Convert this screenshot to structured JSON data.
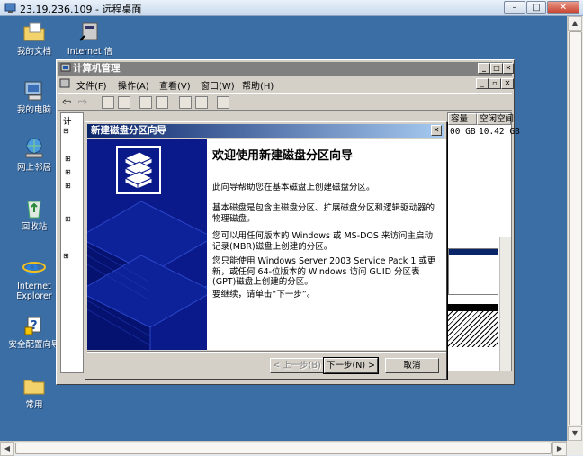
{
  "rdp": {
    "title": "23.19.236.109 - 远程桌面",
    "min": "–",
    "max": "□",
    "close": "✕"
  },
  "desktop_icons": [
    {
      "name": "my-documents",
      "label": "我的文档"
    },
    {
      "name": "internet-shortcut",
      "label": "Internet 信\n息服务(..."
    },
    {
      "name": "my-computer",
      "label": "我的电脑"
    },
    {
      "name": "network-places",
      "label": "网上邻居"
    },
    {
      "name": "recycle-bin",
      "label": "回收站"
    },
    {
      "name": "internet-explorer",
      "label": "Internet\nExplorer"
    },
    {
      "name": "security-config",
      "label": "安全配置向导"
    },
    {
      "name": "common-folder",
      "label": "常用"
    }
  ],
  "cm": {
    "title": "计算机管理",
    "menu": [
      "文件(F)",
      "操作(A)",
      "查看(V)",
      "窗口(W)",
      "帮助(H)"
    ],
    "tree_root": "计",
    "columns": [
      "容量",
      "空闲空间"
    ],
    "row": [
      "00 GB",
      "10.42 GB"
    ]
  },
  "wizard": {
    "title": "新建磁盘分区向导",
    "close": "✕",
    "heading": "欢迎使用新建磁盘分区向导",
    "p1": "此向导帮助您在基本磁盘上创建磁盘分区。",
    "p2": "基本磁盘是包含主磁盘分区、扩展磁盘分区和逻辑驱动器的物理磁盘。",
    "p3": "您可以用任何版本的 Windows 或 MS-DOS 来访问主启动记录(MBR)磁盘上创建的分区。",
    "p4": "您只能使用 Windows Server 2003 Service Pack 1 或更新，或任何 64-位版本的 Windows 访问 GUID 分区表(GPT)磁盘上创建的分区。",
    "p5": "要继续，请单击“下一步”。",
    "back": "< 上一步(B)",
    "next": "下一步(N) >",
    "cancel": "取消"
  },
  "colors": {
    "desktop": "#3a6ea5",
    "wizard_banner": "#0a1a8a",
    "title_active": "#0a246a"
  }
}
